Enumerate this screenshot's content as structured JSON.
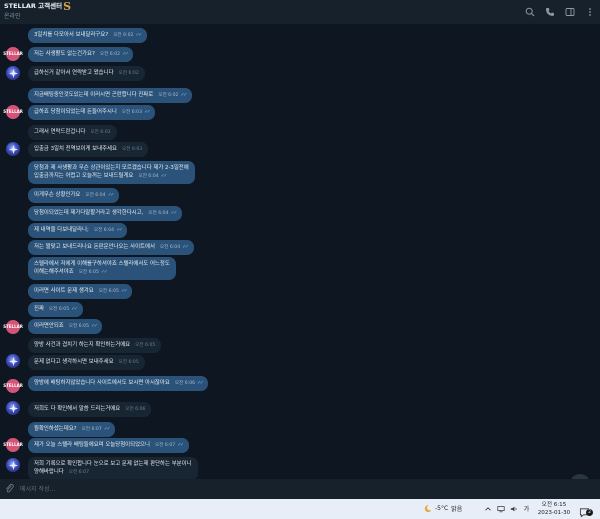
{
  "header": {
    "title": "STELLAR 고객센터",
    "logo_glyph": "S",
    "status": "온라인",
    "icons": [
      "search-icon",
      "phone-icon",
      "sidebar-icon",
      "more-icon"
    ]
  },
  "messages": [
    {
      "dir": "out",
      "text": "3일치를 다모아서 보내달라구요?",
      "time": "오전 6:02",
      "read": true
    },
    {
      "dir": "in",
      "avatar": "pink",
      "text": "저는 사생활도 없는건가요?",
      "time": "오전 6:02",
      "read": true
    },
    {
      "dir": "in",
      "avatar": "logo",
      "text": "급하신거 같아서 연락받고 왔습니다",
      "time": "오전 6:02",
      "read": false
    },
    {
      "dir": "out",
      "text": "지금배팅중인것도있는데 이러시면 곤란합니다 진짜로",
      "time": "오전 6:02",
      "read": true
    },
    {
      "dir": "in",
      "avatar": "pink",
      "text": "급하죠 당첨이되었는데 돈들어주시니",
      "time": "오전 6:03",
      "read": true
    },
    {
      "dir": "in",
      "avatar": "logo",
      "text": "그래서 연락드린겁니다",
      "time": "오전 6:03",
      "read": false
    },
    {
      "dir": "in",
      "avatar": "logo",
      "text": "입출금 3일치 전역보이게 보내주세요",
      "time": "오전 6:03",
      "read": false
    },
    {
      "dir": "out",
      "lines": [
        "당첨과 제 사생활과 무슨 상관이있는지 모르겠습니다 제가 2-3일전에",
        "입출금까지는 어렵고 오늘꺼는 보내드릴게요"
      ],
      "time": "오전 6:04",
      "read": true
    },
    {
      "dir": "out",
      "text": "이게무슨 상황인가요",
      "time": "오전 6:04",
      "read": true
    },
    {
      "dir": "out",
      "text": "당첨이되었는데 제가다말할거라고 생각한다시고,",
      "time": "오전 6:04",
      "read": true
    },
    {
      "dir": "out",
      "text": "제 내역을 다보내달라니;",
      "time": "오전 6:04",
      "read": true
    },
    {
      "dir": "out",
      "text": "저는 짤맞고 보내드리나요 돈판운안나오는 사이트에서",
      "time": "오전 6:04",
      "read": true
    },
    {
      "dir": "out",
      "lines": [
        "스텔라에서 저에게 이해를구하셔야죠 스텔라에서도 어느정도",
        "이해는해주셔야죠"
      ],
      "time": "오전 6:05",
      "read": true
    },
    {
      "dir": "out",
      "text": "이러면 사이트 문제 생겨요",
      "time": "오전 6:05",
      "read": true
    },
    {
      "dir": "out",
      "text": "진짜",
      "time": "오전 6:05",
      "read": true
    },
    {
      "dir": "in",
      "avatar": "pink",
      "text": "이러면안되죠",
      "time": "오전 6:05",
      "read": true
    },
    {
      "dir": "in",
      "avatar": "none",
      "text": "양방 사건과 겹치기 하는지 확인하는거에요",
      "time": "오전 6:05",
      "read": false
    },
    {
      "dir": "in",
      "avatar": "logo",
      "text": "문제 없다고 생각하시면 보내주세요",
      "time": "오전 6:05",
      "read": false
    },
    {
      "dir": "in",
      "avatar": "pink",
      "text": "양방에 배팅하지않았습니다 사이트에서도 보시면 아시잖아요",
      "time": "오전 6:06",
      "read": true
    },
    {
      "dir": "in",
      "avatar": "logo",
      "text": "저희도 다 확인해서 말씀 드리는거에요",
      "time": "오전 6:06",
      "read": false
    },
    {
      "dir": "out",
      "text": "뭘확인하셨는데요?",
      "time": "오전 6:07",
      "read": true
    },
    {
      "dir": "in",
      "avatar": "pink",
      "text": "제가 오늘 스텔라 배팅들에요며 오늘당첨이되었으니",
      "time": "오전 6:07",
      "read": true
    },
    {
      "dir": "in",
      "avatar": "logo",
      "lines": [
        "저희 기록으로 확인합니다 눈으로 보고 문제 없는제 판단하는 부분이니",
        "양해바랍니다"
      ],
      "time": "오전 6:07",
      "read": false
    }
  ],
  "composer": {
    "placeholder": "메시지 작성..."
  },
  "taskbar": {
    "temp": "-5°C",
    "weather": "맑음",
    "ime": "가",
    "time": "오전 6:15",
    "date": "2023-01-30",
    "notification_count": "2"
  },
  "colors": {
    "background": "#0e1621",
    "header": "#17212b",
    "outgoing_bubble": "#2b5278",
    "incoming_bubble": "#182533",
    "read_check": "#6fb6ee",
    "avatar_pink": "#d45478"
  }
}
